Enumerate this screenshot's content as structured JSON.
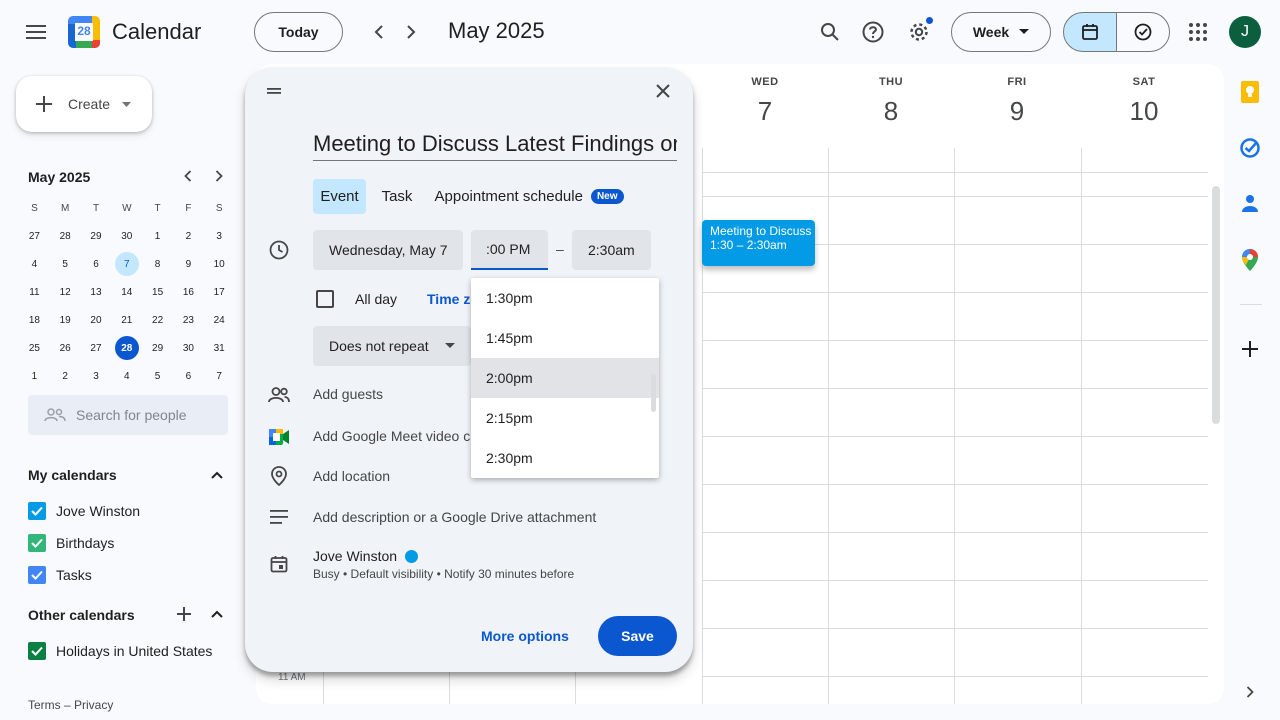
{
  "app": {
    "title": "Calendar",
    "logo_number": "28",
    "avatar_letter": "J"
  },
  "topbar": {
    "today_label": "Today",
    "month_label": "May 2025",
    "view_label": "Week"
  },
  "sidebar": {
    "create_label": "Create",
    "mini_month": "May 2025",
    "weekday_heads": [
      "S",
      "M",
      "T",
      "W",
      "T",
      "F",
      "S"
    ],
    "weeks": [
      [
        "27",
        "28",
        "29",
        "30",
        "1",
        "2",
        "3"
      ],
      [
        "4",
        "5",
        "6",
        "7",
        "8",
        "9",
        "10"
      ],
      [
        "11",
        "12",
        "13",
        "14",
        "15",
        "16",
        "17"
      ],
      [
        "18",
        "19",
        "20",
        "21",
        "22",
        "23",
        "24"
      ],
      [
        "25",
        "26",
        "27",
        "28",
        "29",
        "30",
        "31"
      ],
      [
        "1",
        "2",
        "3",
        "4",
        "5",
        "6",
        "7"
      ]
    ],
    "search_placeholder": "Search for people",
    "my_calendars_title": "My calendars",
    "my_calendars": [
      {
        "label": "Jove Winston",
        "color": "#039be5"
      },
      {
        "label": "Birthdays",
        "color": "#33b679"
      },
      {
        "label": "Tasks",
        "color": "#4285f4"
      }
    ],
    "other_calendars_title": "Other calendars",
    "other_calendars": [
      {
        "label": "Holidays in United States",
        "color": "#0b8043"
      }
    ],
    "footer_terms": "Terms",
    "footer_sep": " – ",
    "footer_privacy": "Privacy"
  },
  "week": {
    "days": [
      {
        "dow": "WED",
        "num": "7"
      },
      {
        "dow": "THU",
        "num": "8"
      },
      {
        "dow": "FRI",
        "num": "9"
      },
      {
        "dow": "SAT",
        "num": "10"
      }
    ],
    "event_title": "Meeting to Discuss",
    "event_time": "1:30 – 2:30am",
    "time_label": "11 AM"
  },
  "dialog": {
    "title_value": "Meeting to Discuss Latest Findings on",
    "tabs": {
      "event": "Event",
      "task": "Task",
      "appointment": "Appointment schedule",
      "new_badge": "New"
    },
    "date_value": "Wednesday, May 7",
    "start_time_value": ":00 PM",
    "dash": "–",
    "end_time_value": "2:30am",
    "all_day_label": "All day",
    "time_zone_label": "Time zo",
    "repeat_value": "Does not repeat",
    "add_guests": "Add guests",
    "add_meet": "Add Google Meet video c",
    "add_location": "Add location",
    "add_description": "Add description or a Google Drive attachment",
    "owner_name": "Jove Winston",
    "owner_details": "Busy • Default visibility • Notify 30 minutes before",
    "more_options": "More options",
    "save": "Save",
    "time_options": [
      "1:30pm",
      "1:45pm",
      "2:00pm",
      "2:15pm",
      "2:30pm"
    ]
  },
  "colors": {
    "accent": "#0b57d0",
    "event": "#039be5"
  }
}
